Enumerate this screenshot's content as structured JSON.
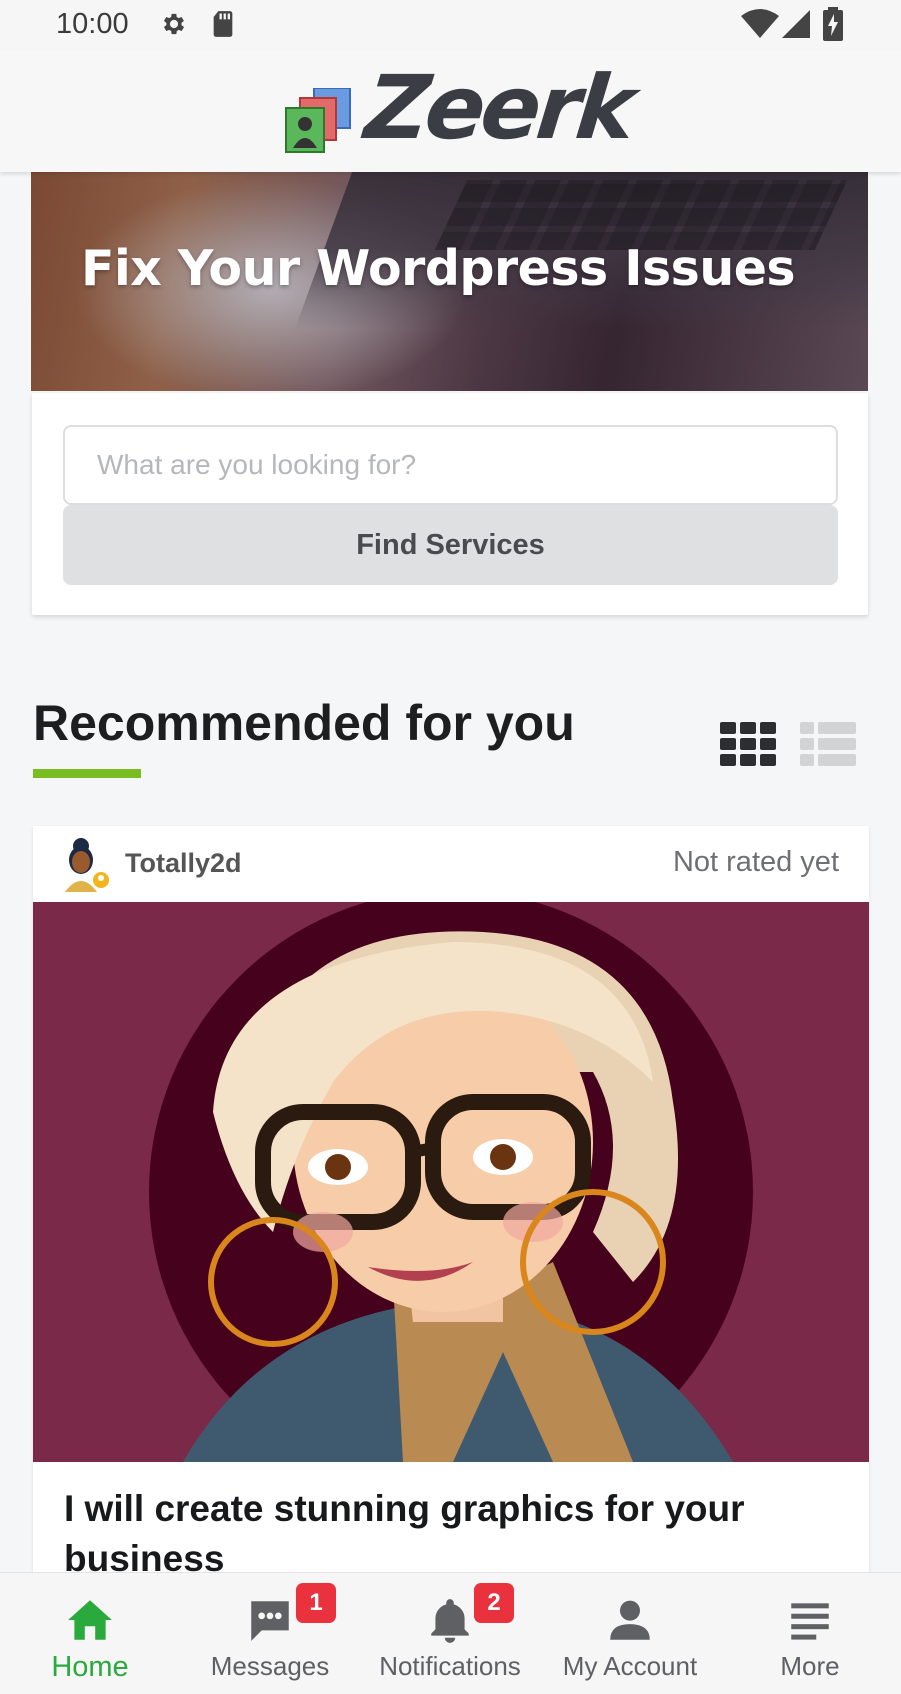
{
  "status_bar": {
    "time": "10:00",
    "icons": [
      "settings-gear-icon",
      "sd-card-icon",
      "wifi-icon",
      "cell-signal-icon",
      "battery-charging-icon"
    ]
  },
  "header": {
    "logo_text": "Zeerk"
  },
  "hero": {
    "title": "Fix Your Wordpress Issues"
  },
  "search": {
    "placeholder": "What are you looking for?",
    "value": "",
    "button_label": "Find Services"
  },
  "recommended": {
    "title": "Recommended for you",
    "view_modes": [
      "grid-view-icon",
      "list-view-icon"
    ],
    "active_view": "grid"
  },
  "listing": {
    "seller_name": "Totally2d",
    "rating_text": "Not rated yet",
    "title": "I will create stunning graphics for your business"
  },
  "bottom_nav": {
    "items": [
      {
        "label": "Home",
        "icon": "home-icon",
        "active": true
      },
      {
        "label": "Messages",
        "icon": "chat-icon",
        "badge": "1"
      },
      {
        "label": "Notifications",
        "icon": "bell-icon",
        "badge": "2"
      },
      {
        "label": "My Account",
        "icon": "person-icon"
      },
      {
        "label": "More",
        "icon": "menu-lines-icon"
      }
    ]
  },
  "colors": {
    "accent_green": "#78be20",
    "active_nav": "#2aa93d",
    "badge_red": "#e9323e",
    "card_image_bg": "#7a2948"
  }
}
